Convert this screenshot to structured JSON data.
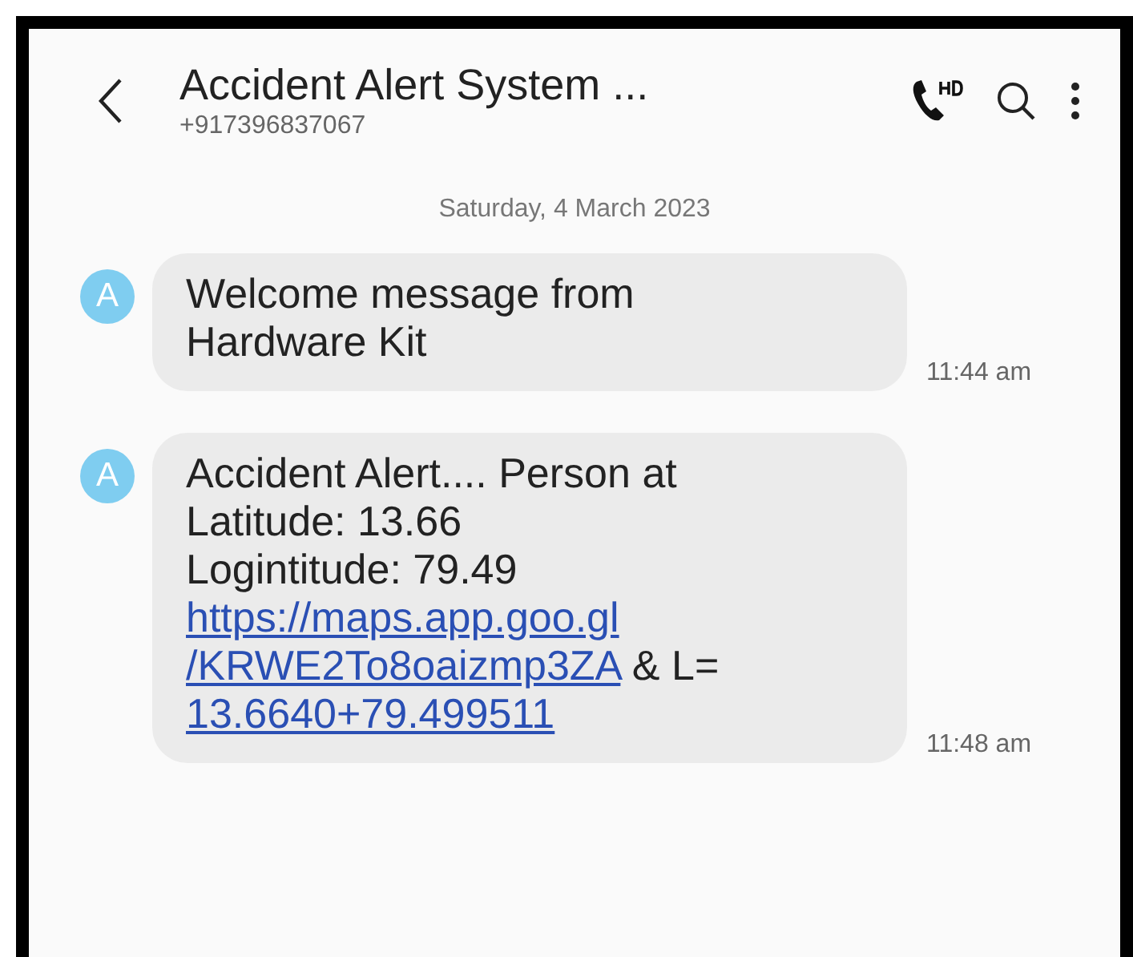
{
  "header": {
    "title": "Accident Alert System ...",
    "subtitle": "+917396837067"
  },
  "date": "Saturday, 4 March 2023",
  "messages": [
    {
      "avatar": "A",
      "time": "11:44 am",
      "lines": [
        [
          {
            "kind": "text",
            "text": "Welcome message from"
          }
        ],
        [
          {
            "kind": "text",
            "text": "Hardware Kit"
          }
        ]
      ]
    },
    {
      "avatar": "A",
      "time": "11:48 am",
      "lines": [
        [
          {
            "kind": "text",
            "text": "Accident Alert.... Person at"
          }
        ],
        [
          {
            "kind": "text",
            "text": "Latitude: 13.66"
          }
        ],
        [
          {
            "kind": "text",
            "text": "Logintitude: 79.49"
          }
        ],
        [
          {
            "kind": "link",
            "text": "https://maps.app.goo.gl"
          }
        ],
        [
          {
            "kind": "link",
            "text": "/KRWE2To8oaizmp3ZA"
          },
          {
            "kind": "text",
            "text": " & L="
          }
        ],
        [
          {
            "kind": "link",
            "text": "13.6640+79.499511"
          }
        ]
      ]
    }
  ]
}
